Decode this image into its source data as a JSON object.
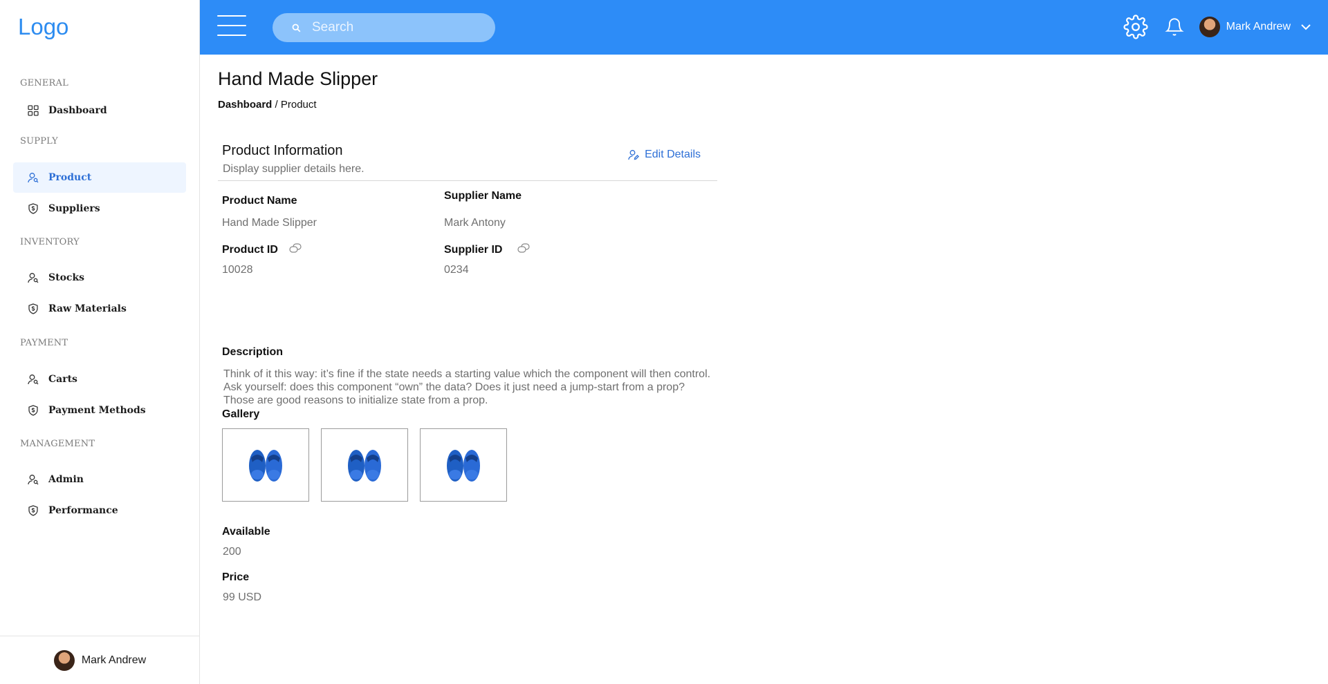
{
  "brand": {
    "logo": "Logo"
  },
  "sidebar": {
    "sections": [
      {
        "title": "GENERAL"
      },
      {
        "title": "SUPPLY"
      },
      {
        "title": "INVENTORY"
      },
      {
        "title": "PAYMENT"
      },
      {
        "title": "MANAGEMENT"
      }
    ],
    "items": [
      {
        "label": "Dashboard",
        "icon": "grid-icon"
      },
      {
        "label": "Product",
        "icon": "user-search-icon",
        "active": true
      },
      {
        "label": "Suppliers",
        "icon": "shield-dollar-icon"
      },
      {
        "label": "Stocks",
        "icon": "user-search-icon"
      },
      {
        "label": "Raw Materials",
        "icon": "shield-dollar-icon"
      },
      {
        "label": "Carts",
        "icon": "user-search-icon"
      },
      {
        "label": "Payment Methods",
        "icon": "shield-dollar-icon"
      },
      {
        "label": "Admin",
        "icon": "user-search-icon"
      },
      {
        "label": "Performance",
        "icon": "shield-dollar-icon"
      }
    ],
    "footer_user": "Mark Andrew"
  },
  "topbar": {
    "search_placeholder": "Search",
    "user_name": "Mark Andrew"
  },
  "page": {
    "title": "Hand Made Slipper",
    "breadcrumb": {
      "parent": "Dashboard",
      "separator": " / ",
      "current": "Product"
    }
  },
  "card": {
    "title": "Product Information",
    "subtitle": "Display supplier details here.",
    "edit_label": "Edit Details",
    "product_name_label": "Product Name",
    "product_name": "Hand Made Slipper",
    "supplier_name_label": "Supplier Name",
    "supplier_name": "Mark Antony",
    "product_id_label": "Product ID",
    "product_id": "10028",
    "supplier_id_label": "Supplier ID",
    "supplier_id": "0234",
    "description_label": "Description",
    "description": "Think of it this way: it’s fine if the state needs a starting value which the component will then control. Ask yourself: does this component “own” the data? Does it just need a jump-start from a prop? Those are good reasons to initialize state from a prop.",
    "gallery_label": "Gallery",
    "gallery_count": 3,
    "available_label": "Available",
    "available": "200",
    "price_label": "Price",
    "price": "99 USD"
  },
  "colors": {
    "accent": "#2d8cf7",
    "active_text": "#2d6fd6",
    "active_bg": "#eef5ff",
    "slipper": "#1f5fc4"
  }
}
